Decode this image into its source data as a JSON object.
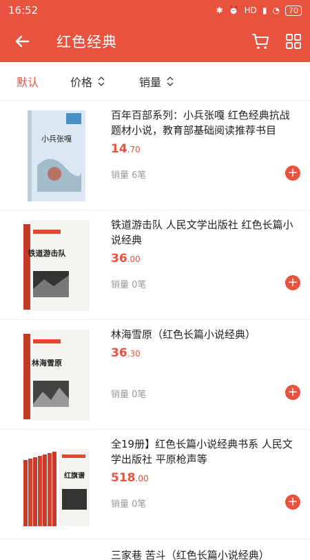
{
  "status": {
    "time": "16:52",
    "network": "HD",
    "battery": "70"
  },
  "header": {
    "title": "红色经典"
  },
  "sort": {
    "default": "默认",
    "price": "价格",
    "sales": "销量"
  },
  "books": [
    {
      "name": "百年百部系列：小兵张嘎 红色经典抗战题材小说，教育部基础阅读推荐书目",
      "price_int": "14",
      "price_dec": ".70",
      "sales": "销量 6笔",
      "cover_title": "小兵张嘎",
      "cover_color": "#cfe0ef"
    },
    {
      "name": "铁道游击队 人民文学出版社 红色长篇小说经典",
      "price_int": "36",
      "price_dec": ".00",
      "sales": "销量 0笔",
      "cover_title": "铁道游击队",
      "cover_color": "#e64530"
    },
    {
      "name": "林海雪原（红色长篇小说经典）",
      "price_int": "36",
      "price_dec": ".30",
      "sales": "销量 0笔",
      "cover_title": "林海雪原",
      "cover_color": "#e64530"
    },
    {
      "name": "全19册】红色长篇小说经典书系 人民文学出版社 平原枪声等",
      "price_int": "518",
      "price_dec": ".00",
      "sales": "销量 0笔",
      "cover_title": "红旗谱",
      "cover_color": "#e64530"
    }
  ],
  "peek": {
    "name": "三家巷 苦斗（红色长篇小说经典）"
  },
  "colors": {
    "accent": "#e8523f"
  }
}
